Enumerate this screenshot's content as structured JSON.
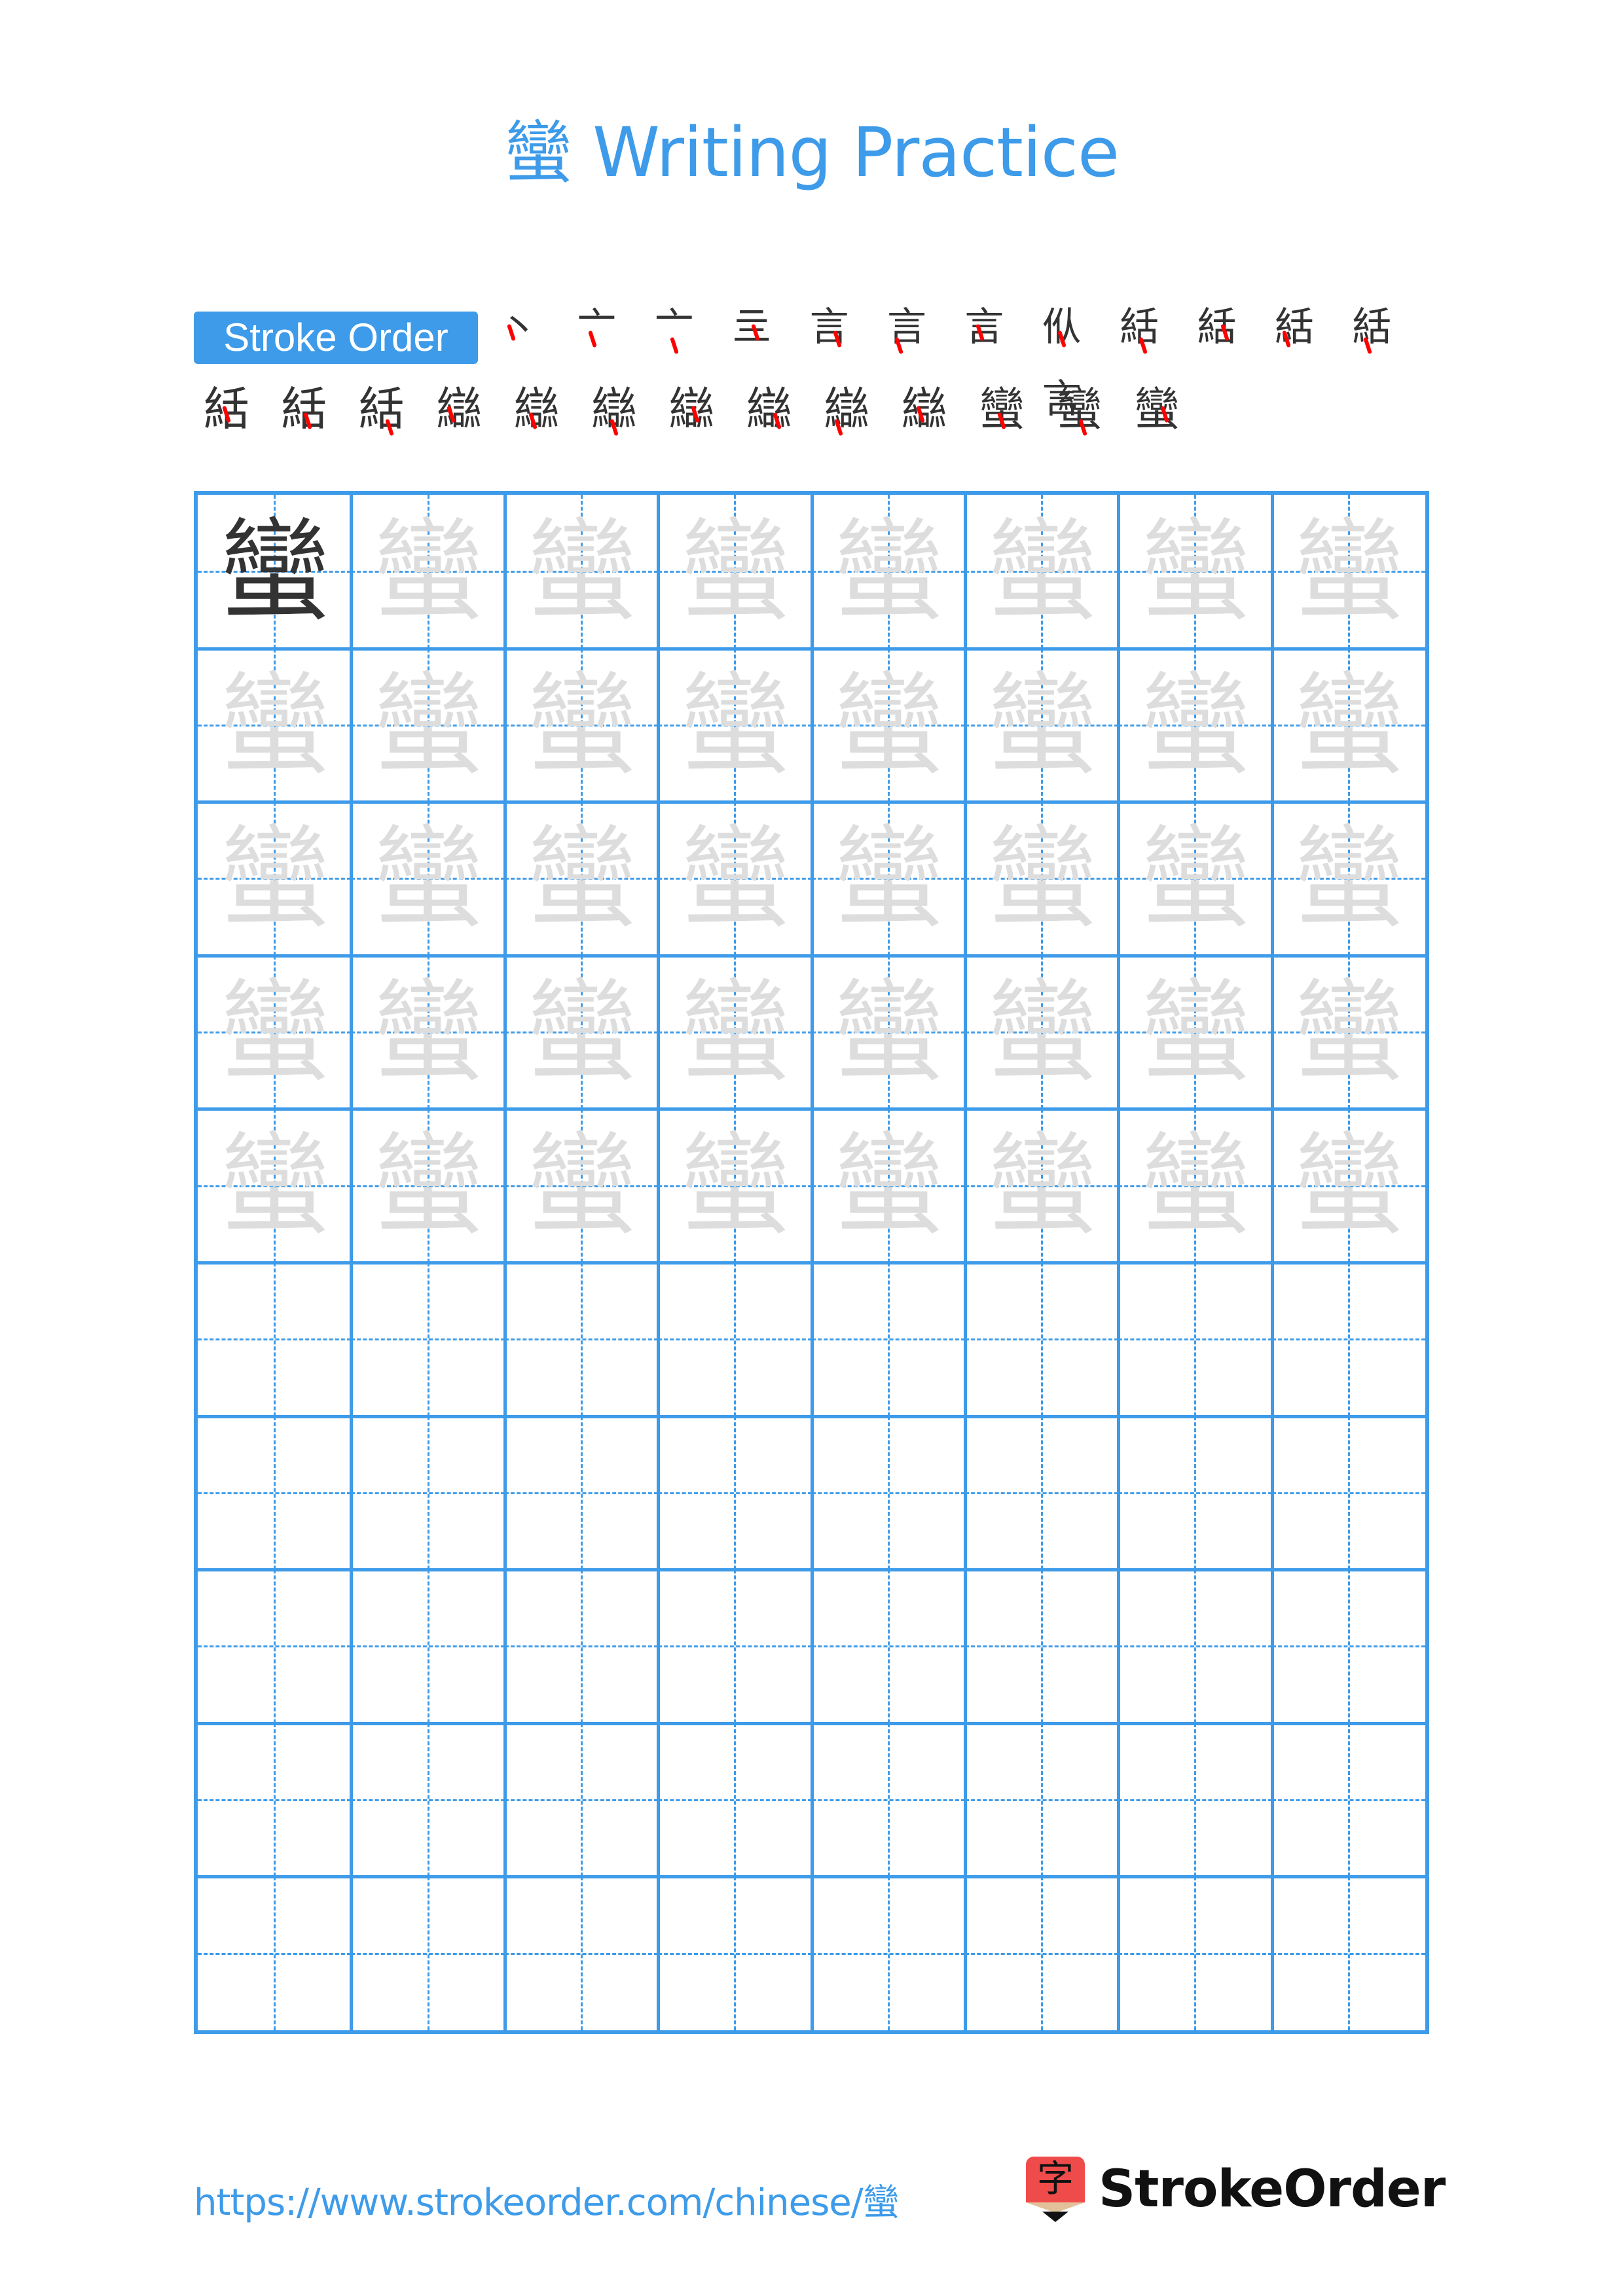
{
  "page": {
    "character": "蠻",
    "title_suffix": "Writing Practice",
    "accent_color": "#3d9be9",
    "stroke_highlight_color": "#ff0000",
    "trace_color": "#dddddd",
    "model_color": "#333333"
  },
  "stroke_order": {
    "label": "Stroke Order",
    "total_strokes": 25,
    "steps": [
      {
        "n": 1,
        "glyph": "丶"
      },
      {
        "n": 2,
        "glyph": "亠"
      },
      {
        "n": 3,
        "glyph": "亠"
      },
      {
        "n": 4,
        "glyph": "亖"
      },
      {
        "n": 5,
        "glyph": "言"
      },
      {
        "n": 6,
        "glyph": "言"
      },
      {
        "n": 7,
        "glyph": "言"
      },
      {
        "n": 8,
        "glyph": "㐺言"
      },
      {
        "n": 9,
        "glyph": "絬"
      },
      {
        "n": 10,
        "glyph": "絬"
      },
      {
        "n": 11,
        "glyph": "絬"
      },
      {
        "n": 12,
        "glyph": "絬"
      },
      {
        "n": 13,
        "glyph": "絬"
      },
      {
        "n": 14,
        "glyph": "絬"
      },
      {
        "n": 15,
        "glyph": "絬"
      },
      {
        "n": 16,
        "glyph": "䜌"
      },
      {
        "n": 17,
        "glyph": "䜌"
      },
      {
        "n": 18,
        "glyph": "䜌"
      },
      {
        "n": 19,
        "glyph": "䜌"
      },
      {
        "n": 20,
        "glyph": "䜌"
      },
      {
        "n": 21,
        "glyph": "䜌"
      },
      {
        "n": 22,
        "glyph": "䜌"
      },
      {
        "n": 23,
        "glyph": "蠻"
      },
      {
        "n": 24,
        "glyph": "蠻"
      },
      {
        "n": 25,
        "glyph": "蠻"
      }
    ]
  },
  "grid": {
    "columns": 8,
    "rows": 10,
    "model_cells": 1,
    "trace_rows": 5,
    "empty_rows": 5
  },
  "footer": {
    "url": "https://www.strokeorder.com/chinese/蠻",
    "logo_glyph": "字",
    "brand": "StrokeOrder"
  }
}
